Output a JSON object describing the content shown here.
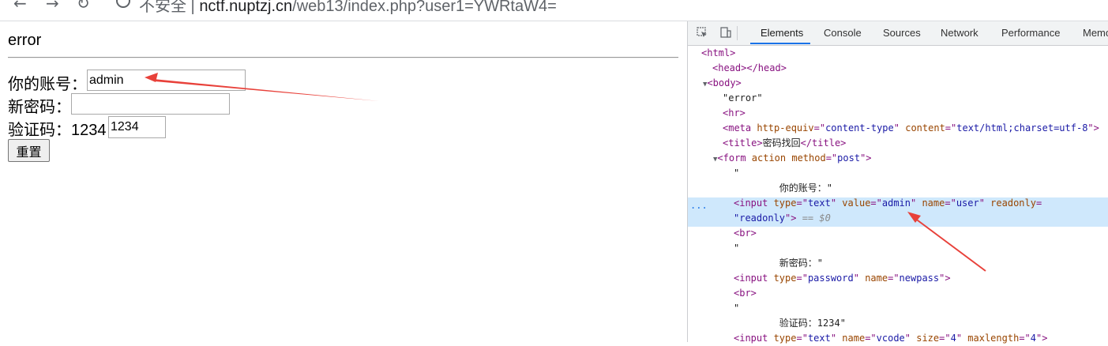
{
  "browser": {
    "back_icon": "←",
    "forward_icon": "→",
    "reload_icon": "↻",
    "url_prefix": "不安全 | ",
    "url_host": "nctf.nuptzj.cn",
    "url_path": "/web13/index.php?user1=YWRtaW4="
  },
  "page": {
    "error_text": "error",
    "account_label": "你的账号：",
    "account_value": "admin",
    "newpass_label": "新密码：",
    "newpass_value": "",
    "vcode_label": "验证码：1234",
    "vcode_value": "1234",
    "reset_label": "重置"
  },
  "annotation": {
    "arrow_color": "#e8413a"
  },
  "devtools": {
    "tabs": [
      "Elements",
      "Console",
      "Sources",
      "Network",
      "Performance",
      "Memo"
    ],
    "active_tab": "Elements",
    "dots": "...",
    "lines": {
      "l1_tag": "<html>",
      "l2_tag": "<head></head>",
      "l3_tag": "<body>",
      "l4_txt": "\"error\"",
      "l5_tag": "<hr>",
      "l6_a": "<meta ",
      "l6_b": "http-equiv",
      "l6_c": "=\"",
      "l6_d": "content-type",
      "l6_e": "\" ",
      "l6_f": "content",
      "l6_g": "=\"",
      "l6_h": "text/html;charset=utf-8",
      "l6_i": "\">",
      "l7_a": "<title>",
      "l7_b": "密码找回",
      "l7_c": "</title>",
      "l8_a": "<form ",
      "l8_b": "action method",
      "l8_c": "=\"",
      "l8_d": "post",
      "l8_e": "\">",
      "l9_txt": "\"",
      "l10_txt": "        你的账号：\"",
      "l11_a": "<input ",
      "l11_b": "type",
      "l11_c": "=\"",
      "l11_d": "text",
      "l11_e": "\" ",
      "l11_f": "value",
      "l11_g": "=\"",
      "l11_h": "admin",
      "l11_i": "\" ",
      "l11_j": "name",
      "l11_k": "=\"",
      "l11_l": "user",
      "l11_m": "\" ",
      "l11_n": "readonly",
      "l11_o": "=",
      "l12_a": "\"",
      "l12_b": "readonly",
      "l12_c": "\">",
      "l12_d": " == $0",
      "l13_tag": "<br>",
      "l14_txt": "\"",
      "l15_txt": "        新密码：\"",
      "l16_a": "<input ",
      "l16_b": "type",
      "l16_c": "=\"",
      "l16_d": "password",
      "l16_e": "\" ",
      "l16_f": "name",
      "l16_g": "=\"",
      "l16_h": "newpass",
      "l16_i": "\">",
      "l17_tag": "<br>",
      "l18_txt": "\"",
      "l19_txt": "        验证码：1234\"",
      "l20_a": "<input ",
      "l20_b": "type",
      "l20_c": "=\"",
      "l20_d": "text",
      "l20_e": "\" ",
      "l20_f": "name",
      "l20_g": "=\"",
      "l20_h": "vcode",
      "l20_i": "\" ",
      "l20_j": "size",
      "l20_k": "=\"",
      "l20_l": "4",
      "l20_m": "\" ",
      "l20_n": "maxlength",
      "l20_o": "=\"",
      "l20_p": "4",
      "l20_q": "\">"
    }
  }
}
